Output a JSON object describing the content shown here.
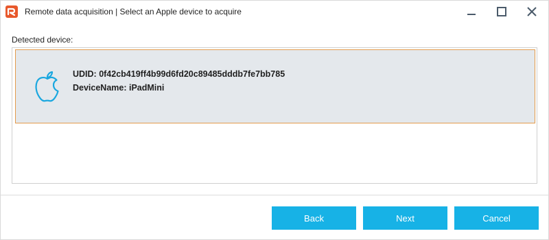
{
  "window": {
    "title": "Remote data acquisition | Select an Apple device to acquire",
    "controls": [
      "minimize-icon",
      "maximize-icon",
      "close-icon"
    ]
  },
  "main": {
    "section_label": "Detected device:",
    "devices": [
      {
        "icon": "apple-icon",
        "udid_line": "UDID: 0f42cb419ff4b99d6fd20c89485dddb7fe7bb785",
        "name_line": "DeviceName: iPadMini",
        "selected": true
      }
    ]
  },
  "footer": {
    "back_label": "Back",
    "next_label": "Next",
    "cancel_label": "Cancel"
  },
  "colors": {
    "accent": "#17b2e6",
    "selection_border": "#e39a4b",
    "selection_fill": "#e4e8ec",
    "app_icon": "#e8582b"
  }
}
